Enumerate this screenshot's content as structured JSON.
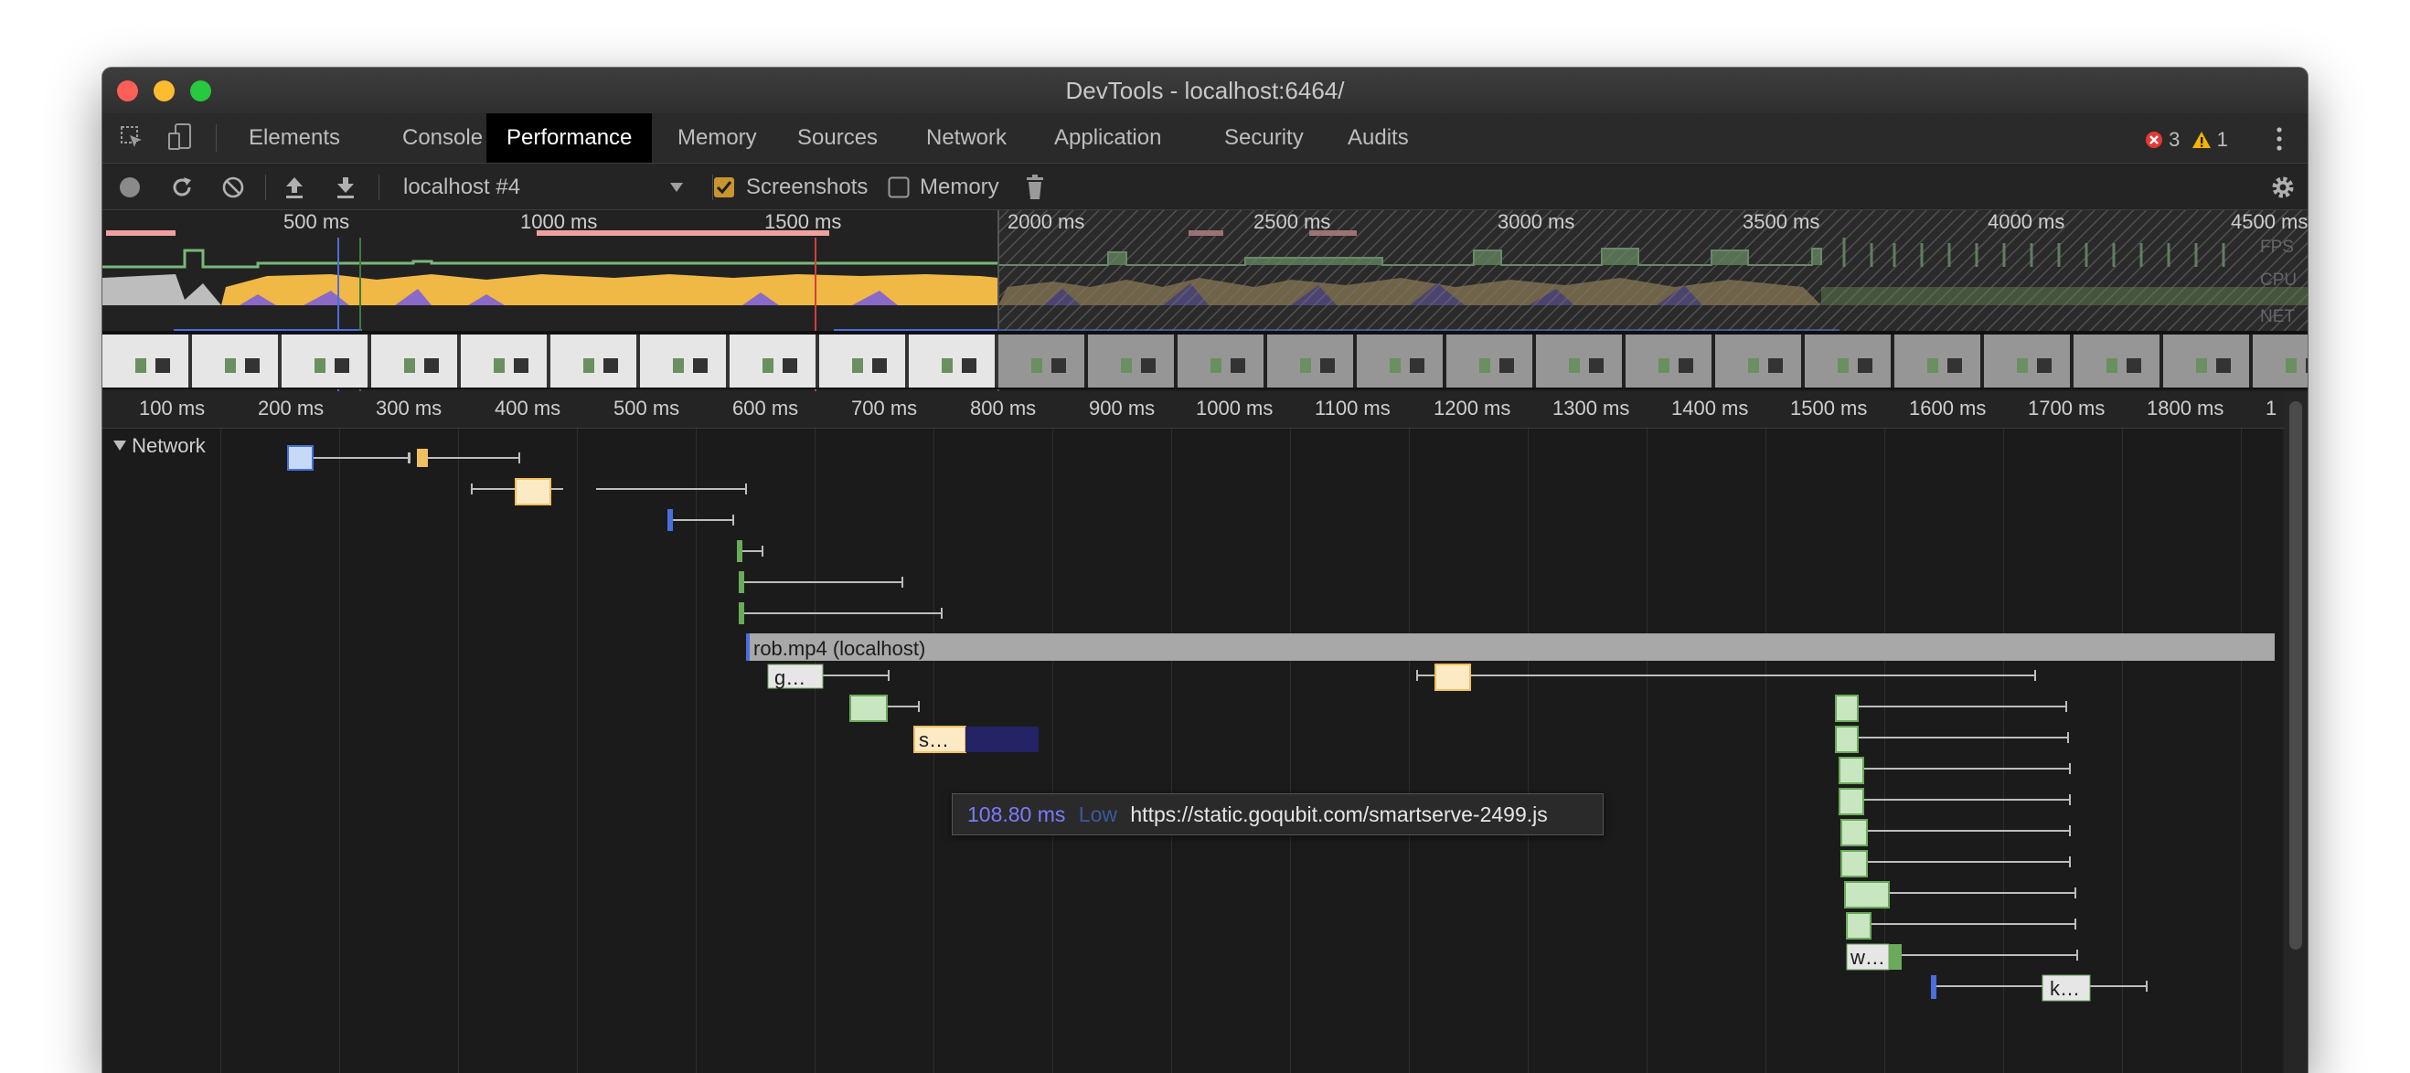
{
  "window": {
    "title": "DevTools - localhost:6464/"
  },
  "tabs": [
    {
      "label": "Elements",
      "active": false
    },
    {
      "label": "Console",
      "active": false
    },
    {
      "label": "Performance",
      "active": true
    },
    {
      "label": "Memory",
      "active": false
    },
    {
      "label": "Sources",
      "active": false
    },
    {
      "label": "Network",
      "active": false
    },
    {
      "label": "Application",
      "active": false
    },
    {
      "label": "Security",
      "active": false
    },
    {
      "label": "Audits",
      "active": false
    }
  ],
  "status": {
    "errors": "3",
    "warnings": "1",
    "error_color": "#e53935",
    "warning_color": "#f4b400"
  },
  "toolbar": {
    "profile_select": "localhost #4",
    "screenshots_label": "Screenshots",
    "screenshots_checked": true,
    "memory_label": "Memory",
    "memory_checked": false
  },
  "overview": {
    "ticks": [
      "500 ms",
      "1000 ms",
      "1500 ms",
      "2000 ms",
      "2500 ms",
      "3000 ms",
      "3500 ms",
      "4000 ms",
      "4500 ms"
    ],
    "track_labels": [
      "FPS",
      "CPU",
      "NET"
    ]
  },
  "ruler": {
    "ticks": [
      "100 ms",
      "200 ms",
      "300 ms",
      "400 ms",
      "500 ms",
      "600 ms",
      "700 ms",
      "800 ms",
      "900 ms",
      "1000 ms",
      "1100 ms",
      "1200 ms",
      "1300 ms",
      "1400 ms",
      "1500 ms",
      "1600 ms",
      "1700 ms",
      "1800 ms",
      "1"
    ]
  },
  "network": {
    "section_label": "Network",
    "video_request_label": "rob.mp4 (localhost)",
    "request_labels": [
      "g…",
      "s…",
      "w…",
      "k…"
    ]
  },
  "tooltip": {
    "duration": "108.80 ms",
    "priority": "Low",
    "url": "https://static.goqubit.com/smartserve-2499.js"
  },
  "colors": {
    "accent_blue": "#4a6edb",
    "script_yellow": "#f0c060",
    "doc_green": "#6aaa5a",
    "image_green": "#c8e6c0"
  }
}
